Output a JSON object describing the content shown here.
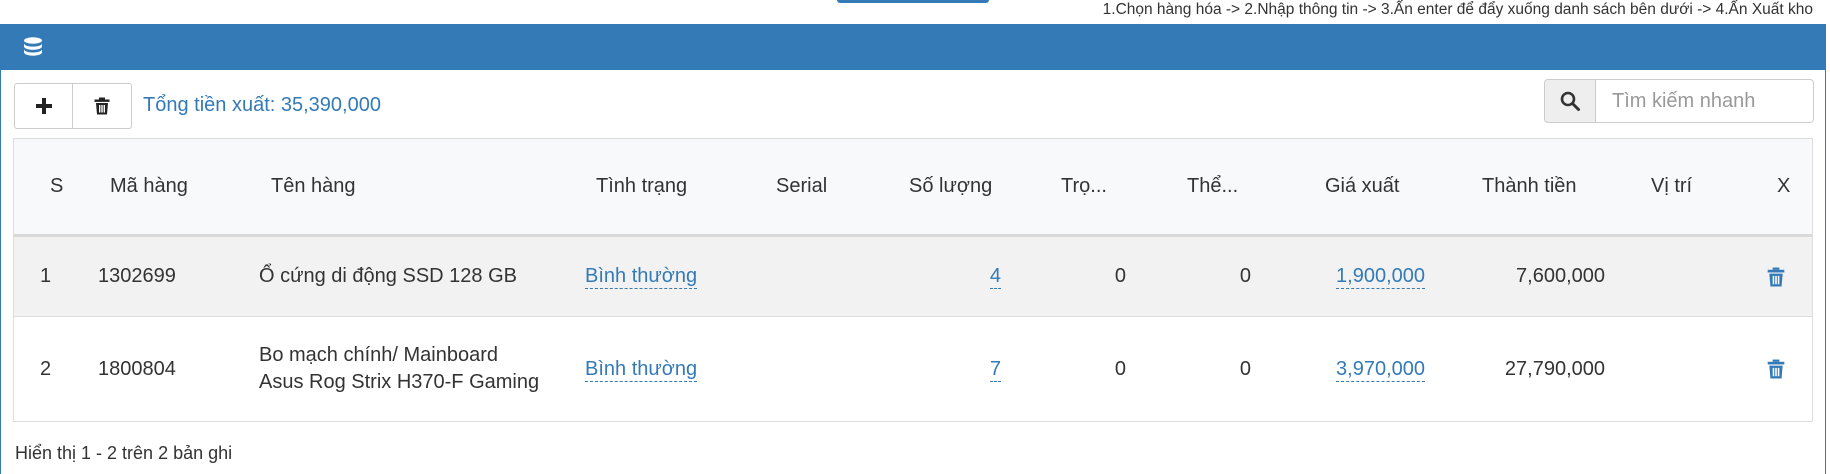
{
  "top": {
    "instructions": "1.Chọn hàng hóa -> 2.Nhập thông tin -> 3.Ấn enter để đẩy xuống danh sách bên dưới -> 4.Ấn Xuất kho"
  },
  "panel": {
    "heading_icon": "database-icon",
    "accent_color": "#337ab7"
  },
  "toolbar": {
    "add_icon": "plus-icon",
    "delete_icon": "trash-icon",
    "total_label": "Tổng tiền xuất: 35,390,000"
  },
  "search": {
    "icon": "search-icon",
    "placeholder": "Tìm kiếm nhanh",
    "value": ""
  },
  "table": {
    "columns": [
      "S",
      "Mã hàng",
      "Tên hàng",
      "Tình trạng",
      "Serial",
      "Số lượng",
      "Trọ...",
      "Thể...",
      "Giá xuất",
      "Thành tiền",
      "Vị trí",
      "X"
    ],
    "rows": [
      {
        "stt": "1",
        "code": "1302699",
        "name_line1": "Ổ cứng di động SSD 128 GB",
        "name_line2": "",
        "status": "Bình thường",
        "serial": "",
        "quantity": "4",
        "weight": "0",
        "volume": "0",
        "price": "1,900,000",
        "amount": "7,600,000",
        "location": ""
      },
      {
        "stt": "2",
        "code": "1800804",
        "name_line1": "Bo mạch chính/ Mainboard",
        "name_line2": "Asus Rog Strix H370-F Gaming",
        "status": "Bình thường",
        "serial": "",
        "quantity": "7",
        "weight": "0",
        "volume": "0",
        "price": "3,970,000",
        "amount": "27,790,000",
        "location": ""
      }
    ]
  },
  "footer": {
    "info": "Hiển thị 1 - 2 trên 2 bản ghi"
  }
}
